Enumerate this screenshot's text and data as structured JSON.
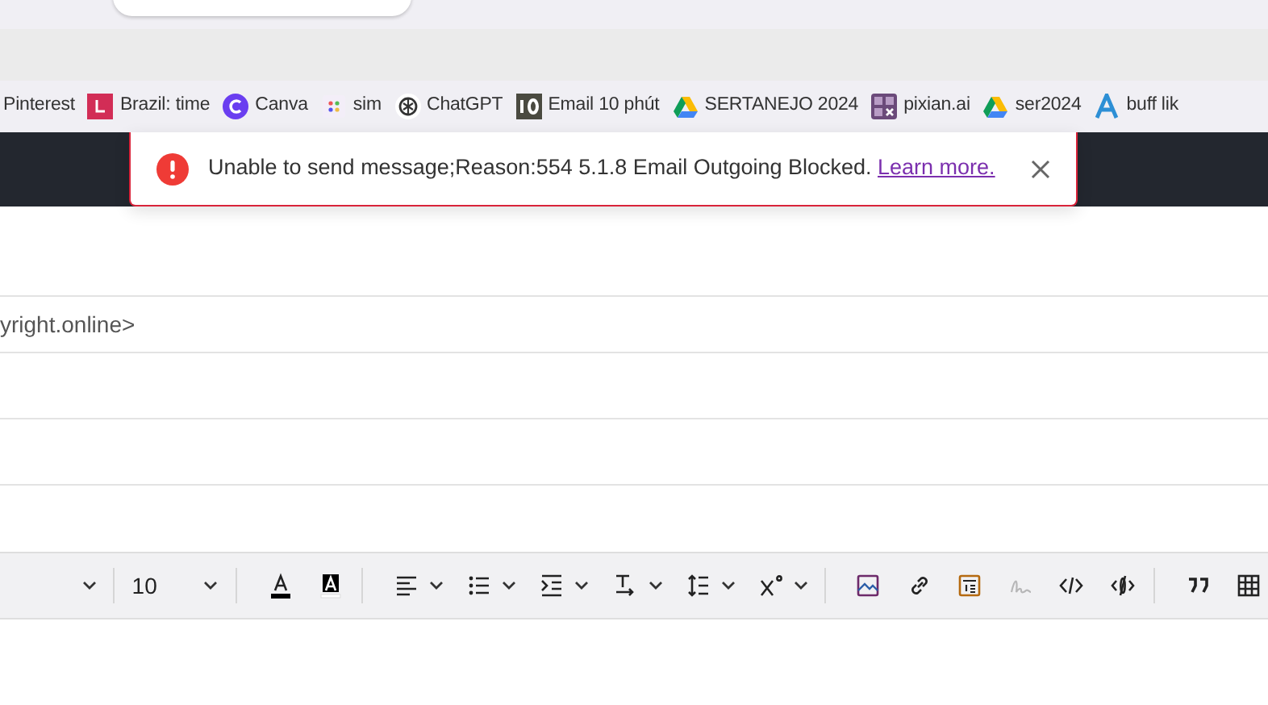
{
  "bookmarks": [
    {
      "label": "Pinterest"
    },
    {
      "label": "Brazil: time"
    },
    {
      "label": "Canva"
    },
    {
      "label": "sim"
    },
    {
      "label": "ChatGPT"
    },
    {
      "label": "Email 10 phút"
    },
    {
      "label": "SERTANEJO 2024"
    },
    {
      "label": "pixian.ai"
    },
    {
      "label": "ser2024"
    },
    {
      "label": "buff lik"
    }
  ],
  "alert": {
    "message": "Unable to send message;Reason:554 5.1.8 Email Outgoing Blocked.",
    "link": "Learn more."
  },
  "recipient": {
    "value": "yright.online>"
  },
  "editor_toolbar": {
    "font_size": "10",
    "tools": [
      {
        "disabled": false
      },
      {
        "disabled": false
      },
      {
        "disabled": false
      },
      {
        "disabled": false
      },
      {
        "disabled": false
      },
      {
        "disabled": false
      },
      {
        "disabled": false
      },
      {
        "disabled": false
      },
      {
        "disabled": false
      },
      {
        "disabled": false
      },
      {
        "disabled": false
      },
      {
        "disabled": true
      },
      {
        "disabled": false
      },
      {
        "disabled": false
      },
      {
        "disabled": false
      },
      {
        "disabled": false
      }
    ]
  }
}
